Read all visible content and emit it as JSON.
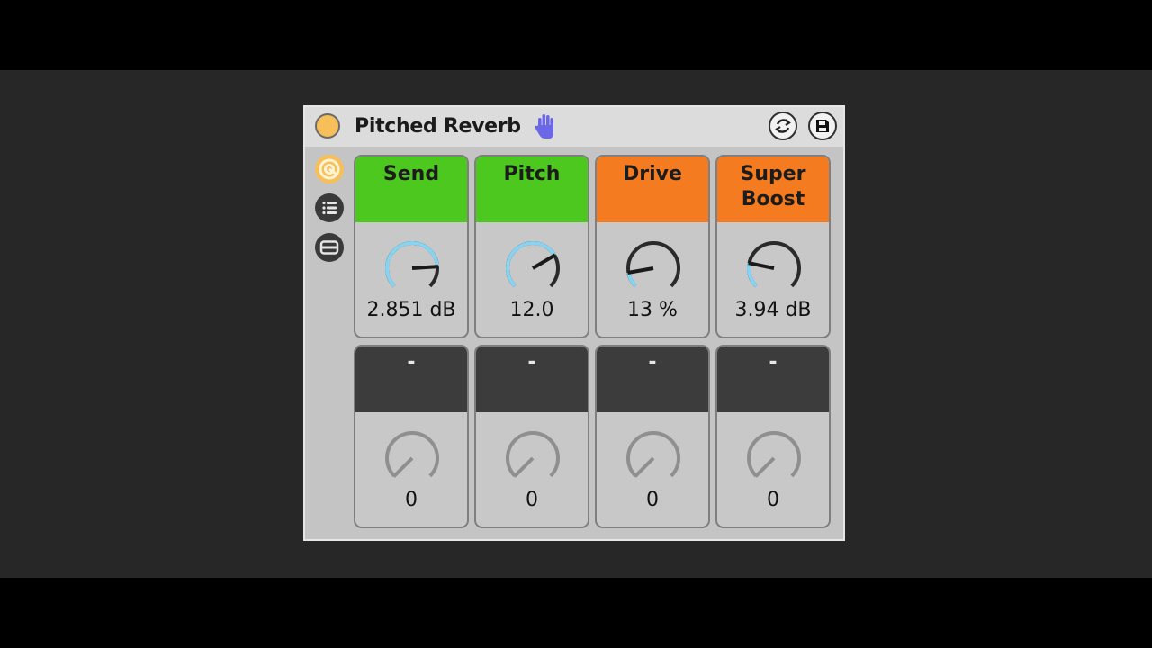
{
  "device": {
    "title": "Pitched Reverb",
    "icons": {
      "power": "power-toggle-icon",
      "hand": "hand-icon",
      "hot_swap": "hot-swap-icon",
      "save": "save-icon",
      "macro": "macro-controls-icon",
      "list": "list-icon",
      "variations": "variations-icon"
    },
    "colors": {
      "power": "#f7bf5a",
      "hand": "#6b67e6",
      "green": "#4cc81e",
      "orange": "#f47b20",
      "dark": "#3c3c3c",
      "knob_arc": "#86d4f2"
    }
  },
  "macros": [
    {
      "name": "Send",
      "value": "2.851 dB",
      "color": "green",
      "level": 0.82,
      "active": true
    },
    {
      "name": "Pitch",
      "value": "12.0",
      "color": "green",
      "level": 0.72,
      "active": true
    },
    {
      "name": "Drive",
      "value": "13 %",
      "color": "orange",
      "level": 0.13,
      "active": true
    },
    {
      "name": "Super Boost",
      "value": "3.94 dB",
      "color": "orange",
      "level": 0.21,
      "active": true
    },
    {
      "name": "-",
      "value": "0",
      "color": "dark",
      "level": 0,
      "active": false
    },
    {
      "name": "-",
      "value": "0",
      "color": "dark",
      "level": 0,
      "active": false
    },
    {
      "name": "-",
      "value": "0",
      "color": "dark",
      "level": 0,
      "active": false
    },
    {
      "name": "-",
      "value": "0",
      "color": "dark",
      "level": 0,
      "active": false
    }
  ]
}
